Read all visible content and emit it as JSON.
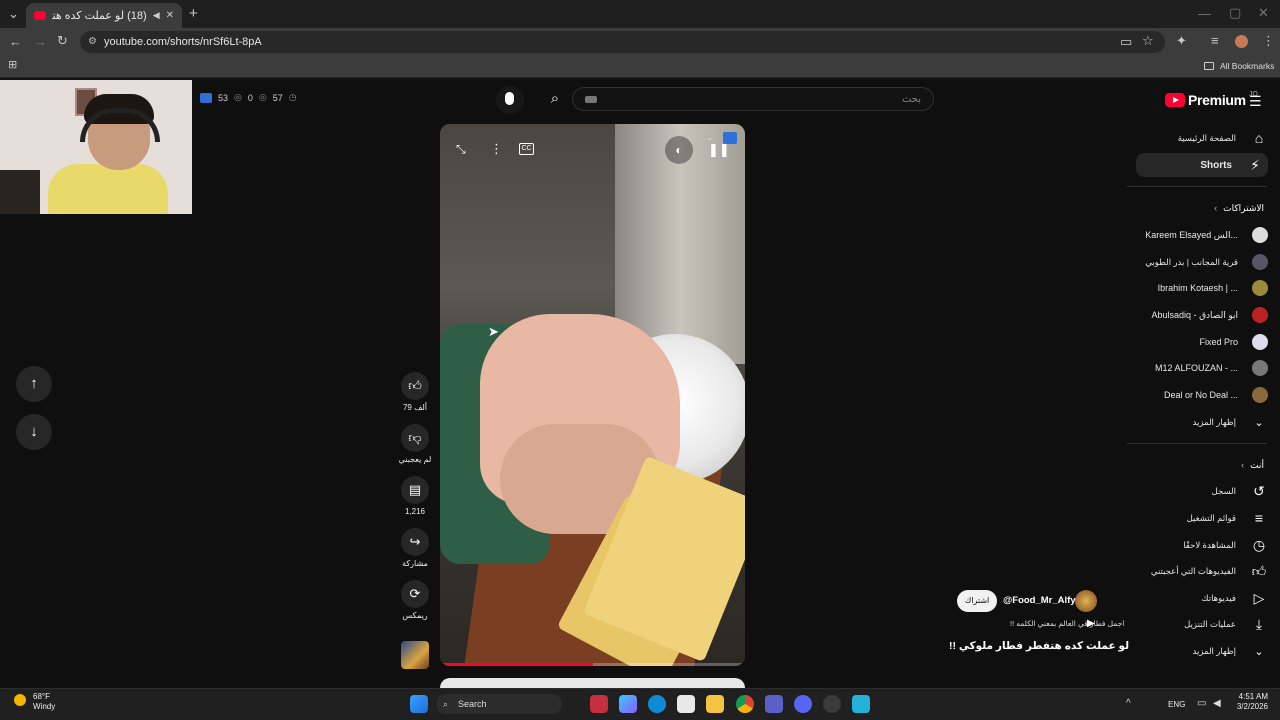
{
  "browser": {
    "tab_title": "(18) لو عملت كده هتفطر فطا",
    "url": "youtube.com/shorts/nrSf6Lt-8pA",
    "bookmarks_label": "All Bookmarks"
  },
  "header": {
    "logo_text": "Premium",
    "logo_region": "JO",
    "search_placeholder": "بحث",
    "stats": [
      "53",
      "0",
      "57"
    ]
  },
  "sidebar": {
    "primary": [
      {
        "label": "الصفحة الرئيسية",
        "icon": "home-icon"
      },
      {
        "label": "Shorts",
        "icon": "shorts-icon"
      }
    ],
    "subscriptions_title": "الاشتراكات",
    "subscriptions": [
      {
        "label": "Kareem Elsayed الس..."
      },
      {
        "label": "قرية المجانب | بدر الطوبي"
      },
      {
        "label": "Ibrahim Kotaesh | ..."
      },
      {
        "label": "Abulsadiq - ابو الصادق"
      },
      {
        "label": "Fixed Pro"
      },
      {
        "label": "M12 ALFOUZAN - ..."
      },
      {
        "label": "Deal or No Deal ..."
      }
    ],
    "show_more": "إظهار المزيد",
    "you_title": "أنت",
    "you_items": [
      {
        "label": "السجل",
        "icon": "history-icon"
      },
      {
        "label": "قوائم التشغيل",
        "icon": "playlist-icon"
      },
      {
        "label": "المشاهدة لاحقًا",
        "icon": "watch-later-icon"
      },
      {
        "label": "الفيديوهات التي أعجبتني",
        "icon": "like-icon"
      },
      {
        "label": "فيديوهاتك",
        "icon": "your-videos-icon"
      },
      {
        "label": "عمليات التنزيل",
        "icon": "download-icon"
      }
    ],
    "show_more_2": "إظهار المزيد"
  },
  "actions": {
    "like_count": "79 ألف",
    "dislike_label": "لم يعجبني",
    "comments_count": "1,216",
    "share_label": "مشاركة",
    "remix_label": "ريمكس"
  },
  "video": {
    "progress": 0.5
  },
  "info": {
    "subscribe_label": "اشتراك",
    "channel_handle": "@Food_Mr_Alfy",
    "description": "اجمل فطار في العالم بمعني الكلمه !!",
    "title": "لو عملت كده هتفطر فطار ملوكي !!"
  },
  "taskbar": {
    "temperature": "68°F",
    "weather": "Windy",
    "search_label": "Search",
    "language": "ENG",
    "time": "4:51 AM",
    "date": "3/2/2026"
  },
  "colors": {
    "youtube_red": "#ff0033",
    "background": "#0f0f0f"
  }
}
